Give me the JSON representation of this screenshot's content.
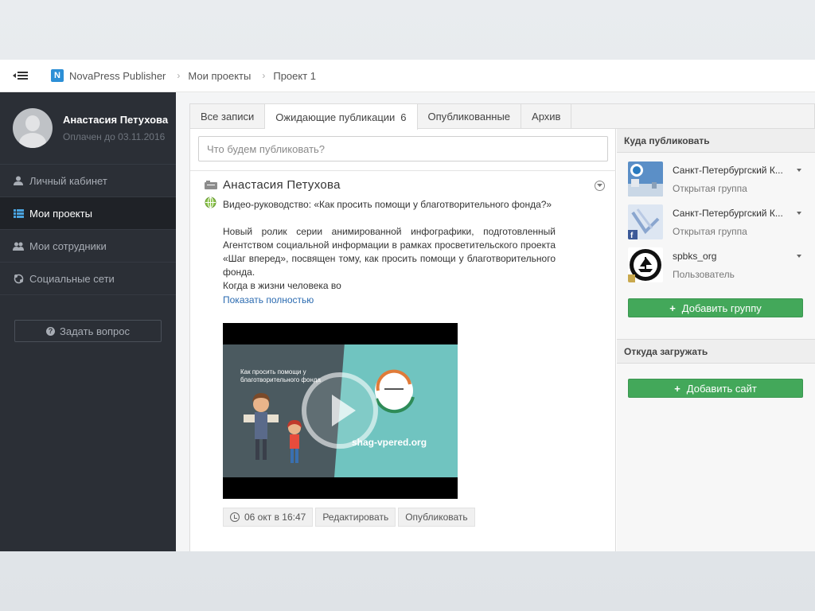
{
  "topbar": {
    "brand_letter": "N",
    "app_name": "NovaPress Publisher",
    "breadcrumb": [
      "Мои проекты",
      "Проект 1"
    ]
  },
  "sidebar": {
    "user_name": "Анастасия Петухова",
    "paid_until": "Оплачен до 03.11.2016",
    "items": [
      {
        "label": "Личный кабинет",
        "icon": "user-icon",
        "active": false
      },
      {
        "label": "Мои проекты",
        "icon": "grid-list-icon",
        "active": true
      },
      {
        "label": "Мои сотрудники",
        "icon": "users-icon",
        "active": false
      },
      {
        "label": "Социальные сети",
        "icon": "network-icon",
        "active": false
      }
    ],
    "ask_button": "Задать вопрос"
  },
  "tabs": [
    {
      "label": "Все записи",
      "count": ""
    },
    {
      "label": "Ожидающие публикации",
      "count": "6"
    },
    {
      "label": "Опубликованные",
      "count": ""
    },
    {
      "label": "Архив",
      "count": ""
    }
  ],
  "compose": {
    "placeholder": "Что будем публиковать?"
  },
  "post": {
    "author": "Анастасия Петухова",
    "text_1": "Видео-руководство: «Как просить помощи у благотворительного фонда?»",
    "text_2": "Новый ролик серии анимированной инфографики, подготовленный Агентством социальной информации в рамках просветительского проекта «Шаг вперед», посвящен тому, как просить помощи у благотворительного фонда.",
    "text_3": "Когда в жизни человека во",
    "show_more": "Показать полностью",
    "video_caption_line1": "Как просить помощи у",
    "video_caption_line2": "благотворительного фонда",
    "video_url": "shag-vpered.org",
    "date": "06 окт в 16:47",
    "edit": "Редактировать",
    "publish": "Опубликовать"
  },
  "right": {
    "publish_to": "Куда публиковать",
    "groups": [
      {
        "name": "Санкт-Петербургский К...",
        "type": "Открытая группа"
      },
      {
        "name": "Санкт-Петербургский К...",
        "type": "Открытая группа"
      },
      {
        "name": "spbks_org",
        "type": "Пользователь"
      }
    ],
    "add_group": "Добавить группу",
    "load_from": "Откуда загружать",
    "add_site": "Добавить сайт"
  },
  "colors": {
    "sidebar_bg": "#2b2f36",
    "accent_green": "#43a85a",
    "link_blue": "#2a6ab0",
    "brand_blue": "#2c8fd6"
  }
}
